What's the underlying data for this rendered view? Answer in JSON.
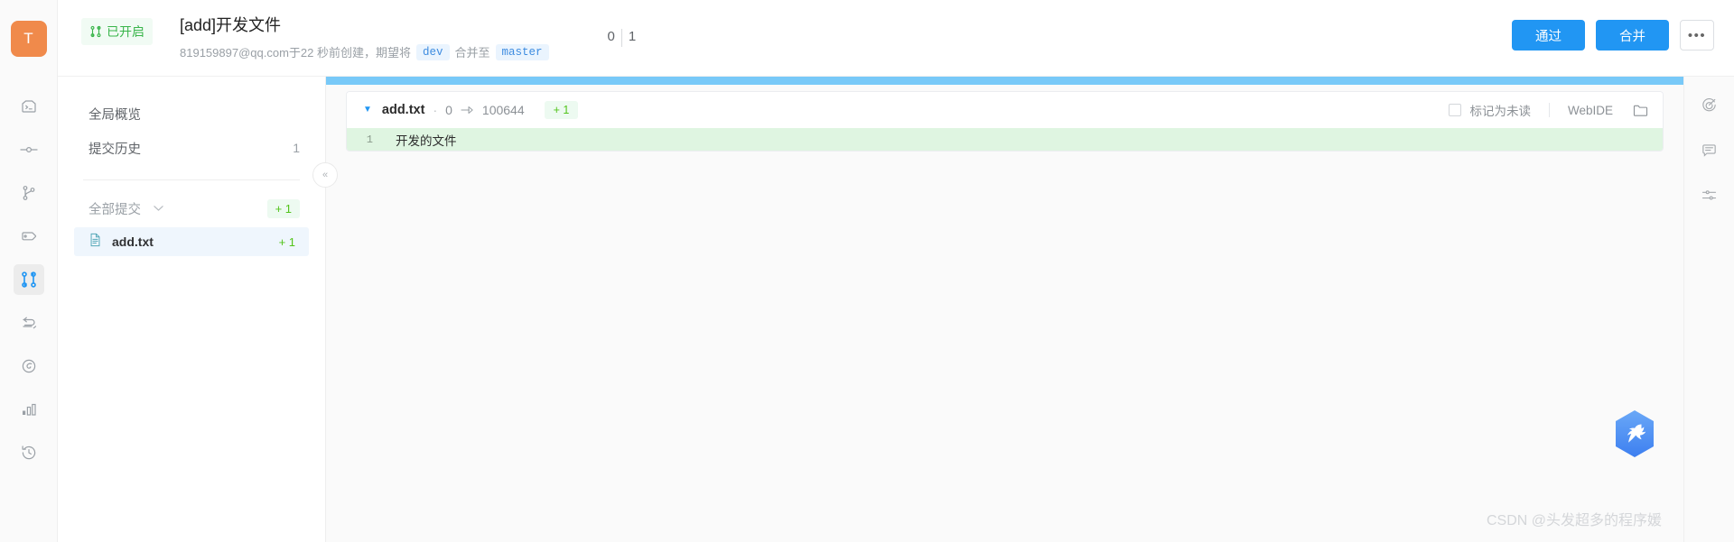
{
  "header": {
    "logo_text": "T",
    "status_badge": "已开启",
    "status_icon": "merge-request-icon",
    "title": "[add]开发文件",
    "sub_prefix": "819159897@qq.com于22 秒前创建，期望将",
    "source_branch": "dev",
    "sub_middle": "合并至",
    "target_branch": "master",
    "count_left": "0",
    "count_right": "1",
    "approve_label": "通过",
    "merge_label": "合并",
    "more_label": "•••"
  },
  "rail": {
    "items": [
      {
        "name": "terminal-icon",
        "active": false
      },
      {
        "name": "commit-line-icon",
        "active": false
      },
      {
        "name": "branch-icon",
        "active": false
      },
      {
        "name": "tag-icon",
        "active": false
      },
      {
        "name": "merge-request-icon",
        "active": true
      },
      {
        "name": "compare-icon",
        "active": false
      },
      {
        "name": "release-icon",
        "active": false
      },
      {
        "name": "statistics-icon",
        "active": false
      },
      {
        "name": "history-icon",
        "active": false
      }
    ]
  },
  "sidenav": {
    "overview_label": "全局概览",
    "history_label": "提交历史",
    "history_count": "1",
    "group_label": "全部提交",
    "group_delta": "+ 1",
    "collapse_icon": "«",
    "files": [
      {
        "name": "add.txt",
        "delta": "+ 1",
        "icon": "file-text-icon",
        "selected": true
      }
    ]
  },
  "diff": {
    "caret": "▼",
    "filename": "add.txt",
    "dot": "·",
    "mode_old": "0",
    "mode_new": "100644",
    "add_pill": "+ 1",
    "mark_unread_label": "标记为未读",
    "webide_label": "WebIDE",
    "folder_icon": "folder-icon",
    "lines": [
      {
        "no": "1",
        "text": "开发的文件",
        "kind": "add"
      }
    ]
  },
  "right_rail": {
    "items": [
      {
        "name": "target-icon"
      },
      {
        "name": "comment-icon"
      },
      {
        "name": "settings-sliders-icon"
      }
    ]
  },
  "floating": {
    "name": "hummingbird-badge-icon"
  },
  "watermark": {
    "text": "CSDN @头发超多的程序媛"
  }
}
